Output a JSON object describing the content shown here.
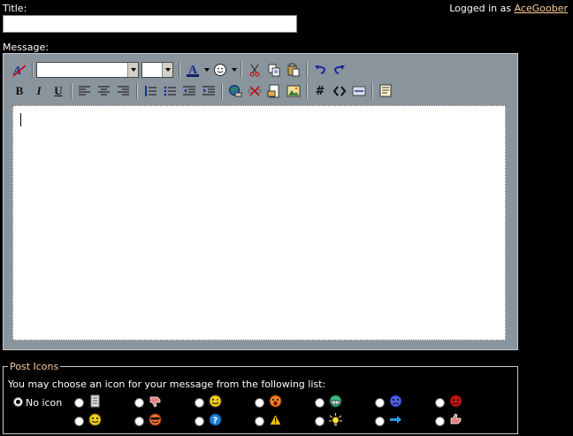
{
  "form": {
    "title_label": "Title:",
    "title_value": "",
    "message_label": "Message:",
    "message_value": ""
  },
  "user": {
    "prefix": "Logged in as",
    "name": "AceGoober"
  },
  "toolbar": {
    "font_value": "",
    "size_value": "",
    "bold": "B",
    "italic": "I",
    "underline": "U",
    "hash": "#"
  },
  "post_icons": {
    "legend": "Post Icons",
    "instruction": "You may choose an icon for your message from the following list:",
    "no_icon_label": "No icon",
    "selected": "none",
    "icons": [
      "document",
      "thumbs-down",
      "smile-wink",
      "angry",
      "grin",
      "sad-blue",
      "mad-red",
      "smile",
      "cool",
      "question",
      "warning",
      "lightbulb",
      "arrow",
      "thumbs-up"
    ]
  },
  "colors": {
    "background": "#000000",
    "editor_panel": "#8a949c",
    "link": "#ffcc99"
  }
}
